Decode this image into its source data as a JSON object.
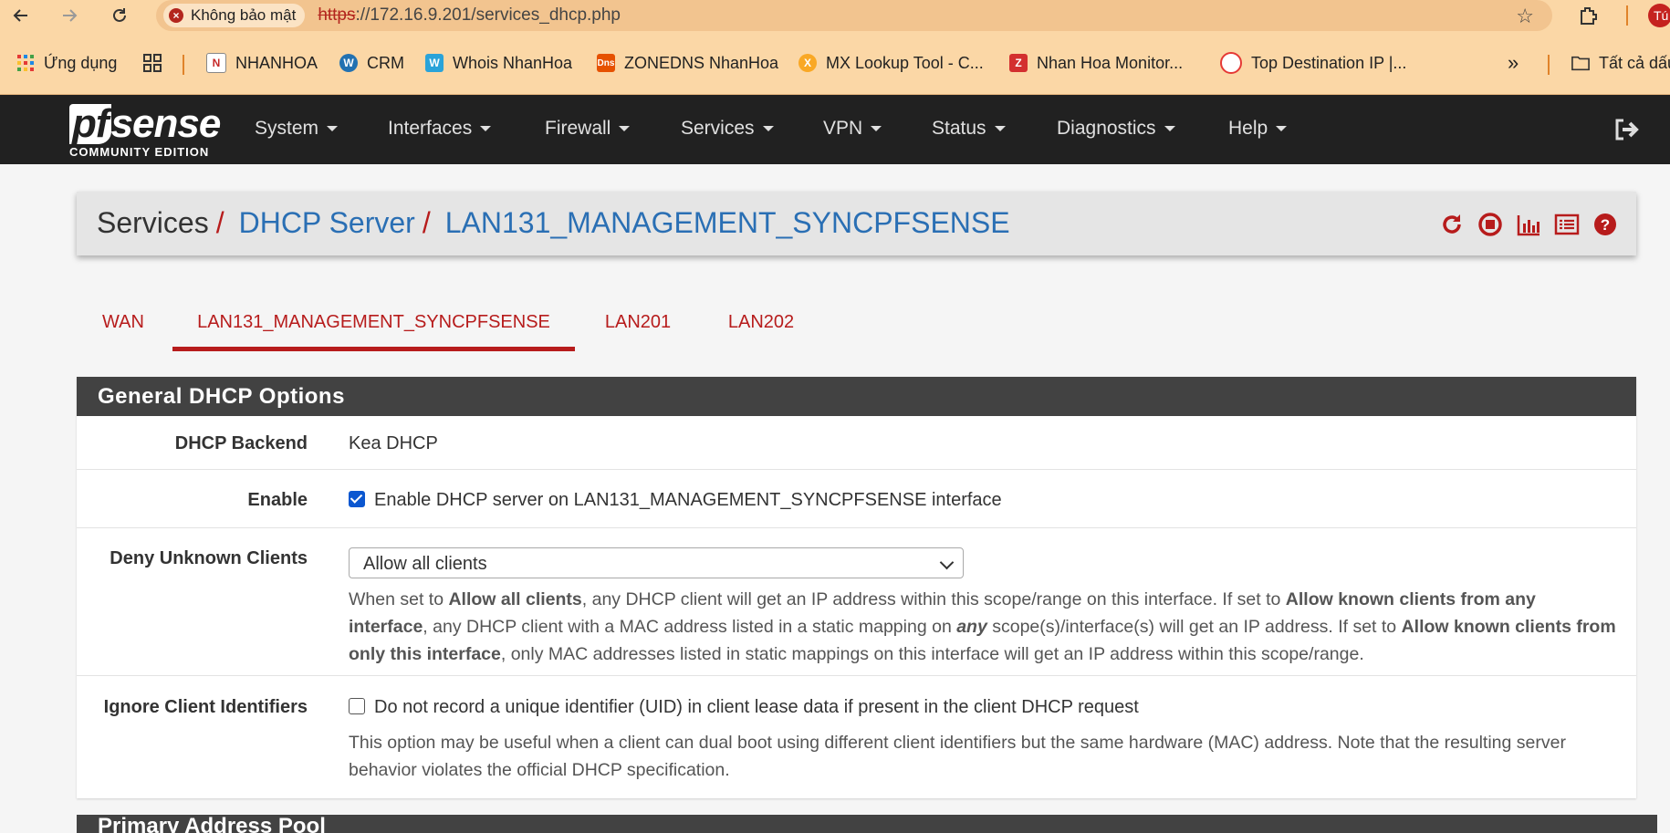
{
  "browser": {
    "security_label": "Không bảo mật",
    "url_scheme": "https",
    "url_rest": "://172.16.9.201/services_dhcp.php",
    "profile_initial": "Tú",
    "bookmarks": [
      {
        "label": "Ứng dụng",
        "icon": "apps-grid-icon"
      },
      {
        "label": "NHANHOA",
        "icon": "nhanhoa-icon"
      },
      {
        "label": "CRM",
        "icon": "wordpress-icon"
      },
      {
        "label": "Whois NhanHoa",
        "icon": "whois-icon"
      },
      {
        "label": "ZONEDNS NhanHoa",
        "icon": "dns-icon"
      },
      {
        "label": "MX Lookup Tool - C...",
        "icon": "mxtoolbox-icon"
      },
      {
        "label": "Nhan Hoa Monitor...",
        "icon": "zabbix-icon"
      },
      {
        "label": "Top Destination IP |...",
        "icon": "gauge-icon"
      }
    ],
    "all_bookmarks_label": "Tất cả dấu trang"
  },
  "pfsense": {
    "logo_pf": "pf",
    "logo_sense": "sense",
    "logo_sub": "COMMUNITY EDITION",
    "menu": [
      "System",
      "Interfaces",
      "Firewall",
      "Services",
      "VPN",
      "Status",
      "Diagnostics",
      "Help"
    ]
  },
  "breadcrumb": {
    "level1": "Services",
    "level2": "DHCP Server",
    "level3": "LAN131_MANAGEMENT_SYNCPFSENSE",
    "separator": "/"
  },
  "tabs": [
    {
      "label": "WAN",
      "active": false
    },
    {
      "label": "LAN131_MANAGEMENT_SYNCPFSENSE",
      "active": true
    },
    {
      "label": "LAN201",
      "active": false
    },
    {
      "label": "LAN202",
      "active": false
    }
  ],
  "panel": {
    "title": "General DHCP Options",
    "backend_label": "DHCP Backend",
    "backend_value": "Kea DHCP",
    "enable_label": "Enable",
    "enable_checked": true,
    "enable_text": "Enable DHCP server on LAN131_MANAGEMENT_SYNCPFSENSE interface",
    "deny_label": "Deny Unknown Clients",
    "deny_selected": "Allow all clients",
    "deny_help": {
      "p1": "When set to ",
      "b1": "Allow all clients",
      "p2": ", any DHCP client will get an IP address within this scope/range on this interface. If set to ",
      "b2": "Allow known clients from any interface",
      "p3": ", any DHCP client with a MAC address listed in a static mapping on ",
      "bi": "any",
      "p4": " scope(s)/interface(s) will get an IP address. If set to ",
      "b3": "Allow known clients from only this interface",
      "p5": ", only MAC addresses listed in static mappings on this interface will get an IP address within this scope/range."
    },
    "ignore_label": "Ignore Client Identifiers",
    "ignore_checked": false,
    "ignore_text": "Do not record a unique identifier (UID) in client lease data if present in the client DHCP request",
    "ignore_help": "This option may be useful when a client can dual boot using different client identifiers but the same hardware (MAC) address. Note that the resulting server behavior violates the official DHCP specification.",
    "next_section_title": "Primary Address Pool"
  },
  "colors": {
    "navbar": "#212121",
    "accent_red": "#b71c1c",
    "link_blue": "#2a6fb4",
    "panel_head": "#424242",
    "browser_bar": "#fbd7a6"
  }
}
